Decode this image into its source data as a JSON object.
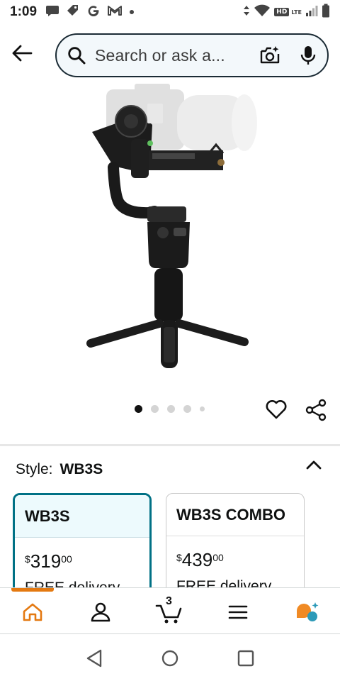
{
  "status_bar": {
    "time": "1:09",
    "network_badge": "HD",
    "network_type": "LTE"
  },
  "header": {
    "search_placeholder": "Search or ask a..."
  },
  "carousel": {
    "total_images": 5,
    "active_index": 0
  },
  "style_selector": {
    "label": "Style:",
    "selected_value": "WB3S",
    "options": [
      {
        "name": "WB3S",
        "price_symbol": "$",
        "price_whole": "319",
        "price_fraction": "00",
        "delivery": "FREE delivery",
        "selected": true
      },
      {
        "name": "WB3S COMBO",
        "price_symbol": "$",
        "price_whole": "439",
        "price_fraction": "00",
        "delivery": "FREE delivery",
        "selected": false
      }
    ]
  },
  "bottom_nav": {
    "cart_count": "3",
    "active_item": "home"
  },
  "colors": {
    "selected_border": "#007185",
    "active_nav": "#e47911",
    "search_border": "#1b2b35"
  }
}
